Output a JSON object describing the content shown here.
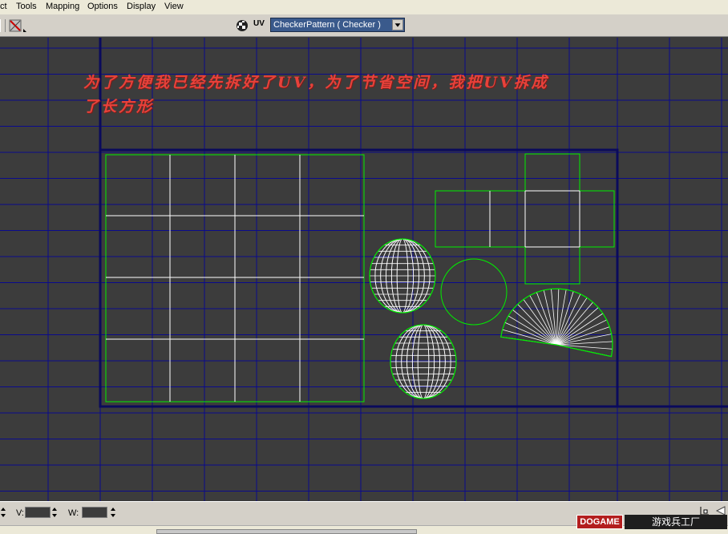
{
  "menubar": {
    "items": [
      "ct",
      "Tools",
      "Mapping",
      "Options",
      "Display",
      "View"
    ]
  },
  "toolbar": {
    "texture_selector": "CheckerPattern  ( Checker )",
    "uv_label": "UV"
  },
  "annotation": {
    "line1": "为了方便我已经先拆好了UV，为了节省空间，我把UV拆成",
    "line2": "了长方形"
  },
  "bottombar": {
    "v_label": "V:",
    "w_label": "W:"
  },
  "watermark": {
    "brand": "DOGAME",
    "subtitle": "游戏兵工厂"
  },
  "colors": {
    "viewport_bg": "#3c3c3c",
    "grid_line": "#0a0a8c",
    "uv_border": "#00ee00",
    "uv_seam": "#ffffff",
    "uv_tile": "#0a0a5c",
    "annotation": "#e8413a"
  },
  "icons": [
    "checker-icon",
    "uv-icon",
    "dropdown-arrow-icon",
    "spin-arrow-icon",
    "corner-icon",
    "arrow-left-icon"
  ]
}
